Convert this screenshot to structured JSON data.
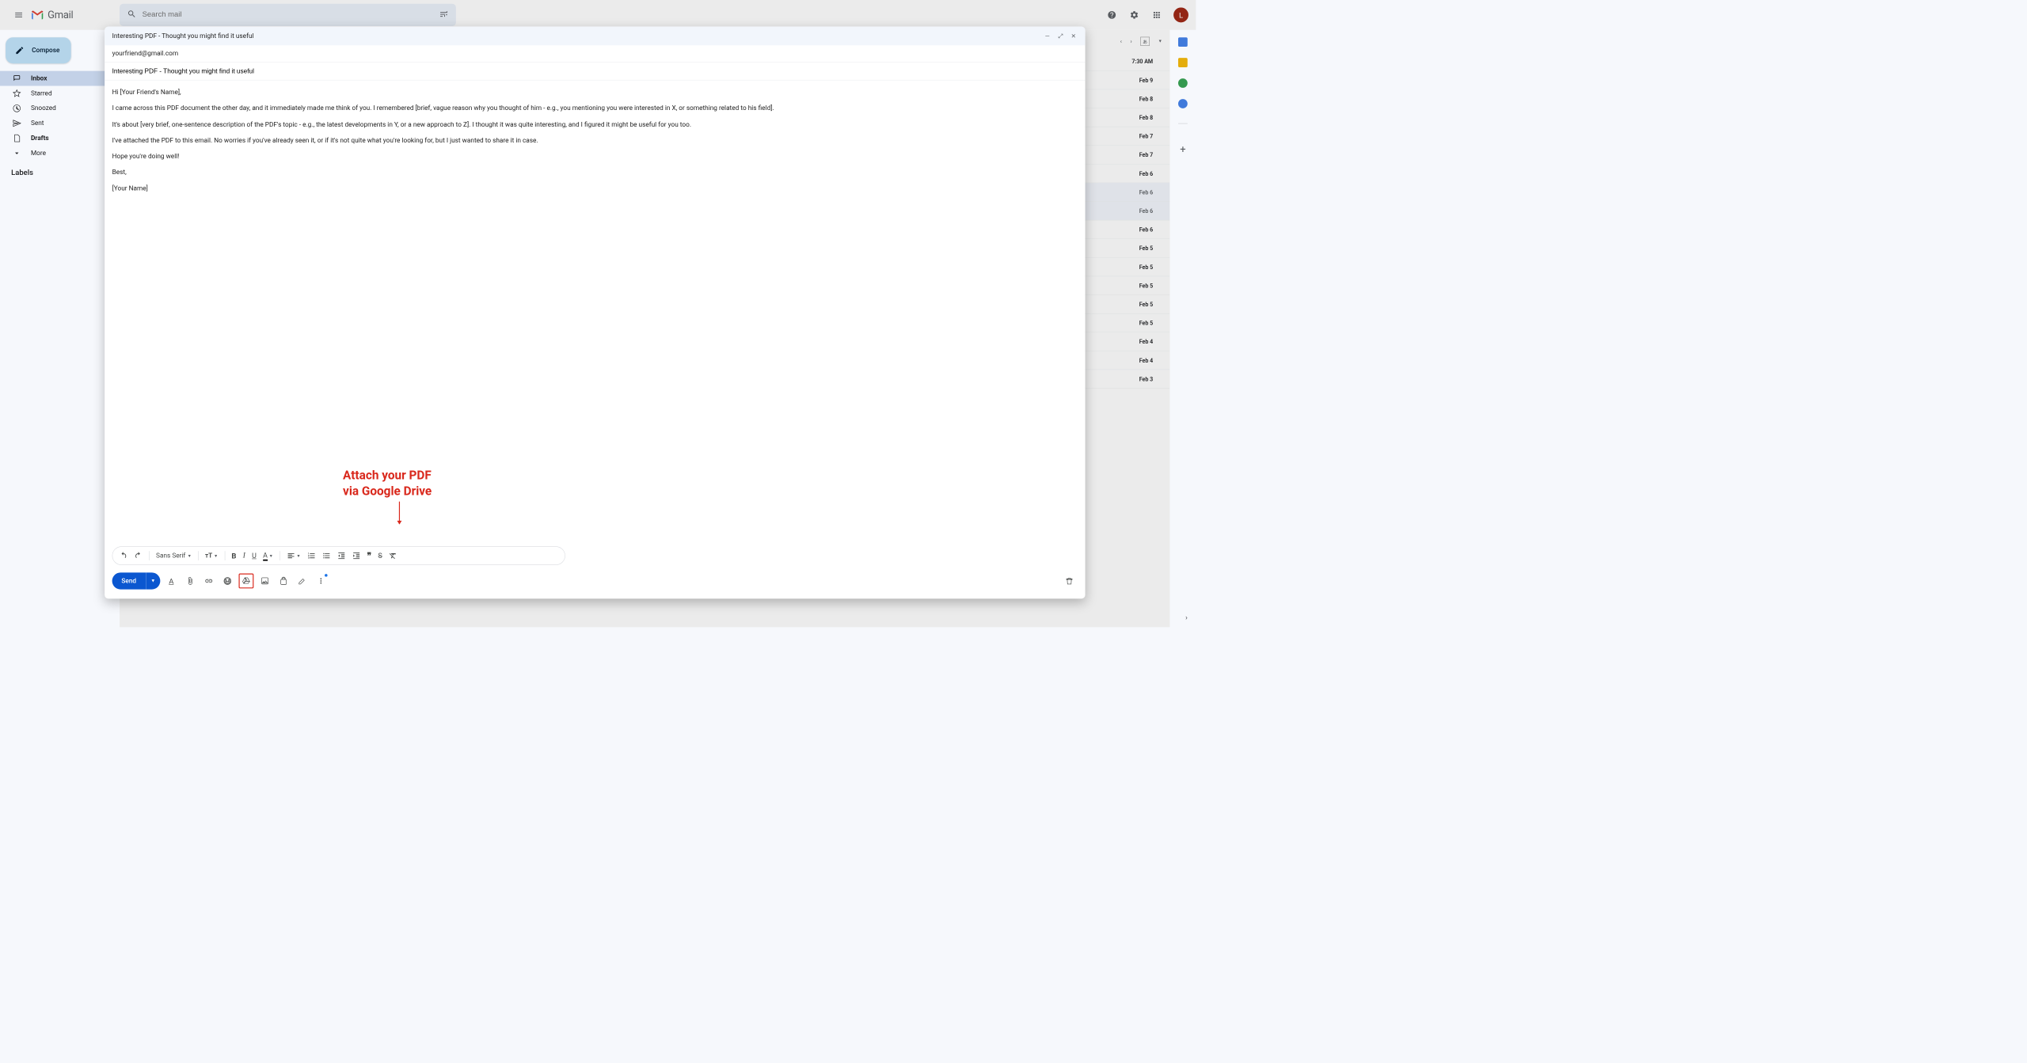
{
  "header": {
    "app_name": "Gmail",
    "search_placeholder": "Search mail",
    "avatar_initial": "L"
  },
  "sidebar": {
    "compose": "Compose",
    "items": [
      {
        "label": "Inbox",
        "bold": true,
        "active": true
      },
      {
        "label": "Starred"
      },
      {
        "label": "Snoozed"
      },
      {
        "label": "Sent"
      },
      {
        "label": "Drafts",
        "bold": true
      },
      {
        "label": "More"
      }
    ],
    "labels_header": "Labels"
  },
  "inbox_dates": [
    "7:30 AM",
    "Feb 9",
    "Feb 8",
    "Feb 8",
    "Feb 7",
    "Feb 7",
    "Feb 6",
    "Feb 6",
    "Feb 6",
    "Feb 6",
    "Feb 5",
    "Feb 5",
    "Feb 5",
    "Feb 5",
    "Feb 5",
    "Feb 4",
    "Feb 4",
    "Feb 3"
  ],
  "inbox_unread_flags": [
    true,
    true,
    true,
    true,
    true,
    true,
    true,
    false,
    false,
    true,
    true,
    true,
    true,
    true,
    true,
    true,
    true,
    true
  ],
  "compose_dialog": {
    "title": "Interesting PDF - Thought you might find it useful",
    "to": "yourfriend@gmail.com",
    "subject": "Interesting PDF - Thought you might find it useful",
    "body": {
      "p1": "Hi [Your Friend's Name],",
      "p2": "I came across this PDF document the other day, and it immediately made me think of you. I remembered [brief, vague reason why you thought of him - e.g., you mentioning you were interested in X, or something related to his field].",
      "p3": "It's about [very brief, one-sentence description of the PDF's topic - e.g., the latest developments in Y, or a new approach to Z]. I thought it was quite interesting, and I figured it might be useful for you too.",
      "p4": "I've attached the PDF to this email. No worries if you've already seen it, or if it's not quite what you're looking for, but I just wanted to share it in case.",
      "p5": "Hope you're doing well!",
      "p6": "Best,",
      "p7": "[Your Name]"
    },
    "annotation_line1": "Attach your PDF",
    "annotation_line2": "via Google Drive",
    "font_family": "Sans Serif",
    "send_label": "Send"
  }
}
